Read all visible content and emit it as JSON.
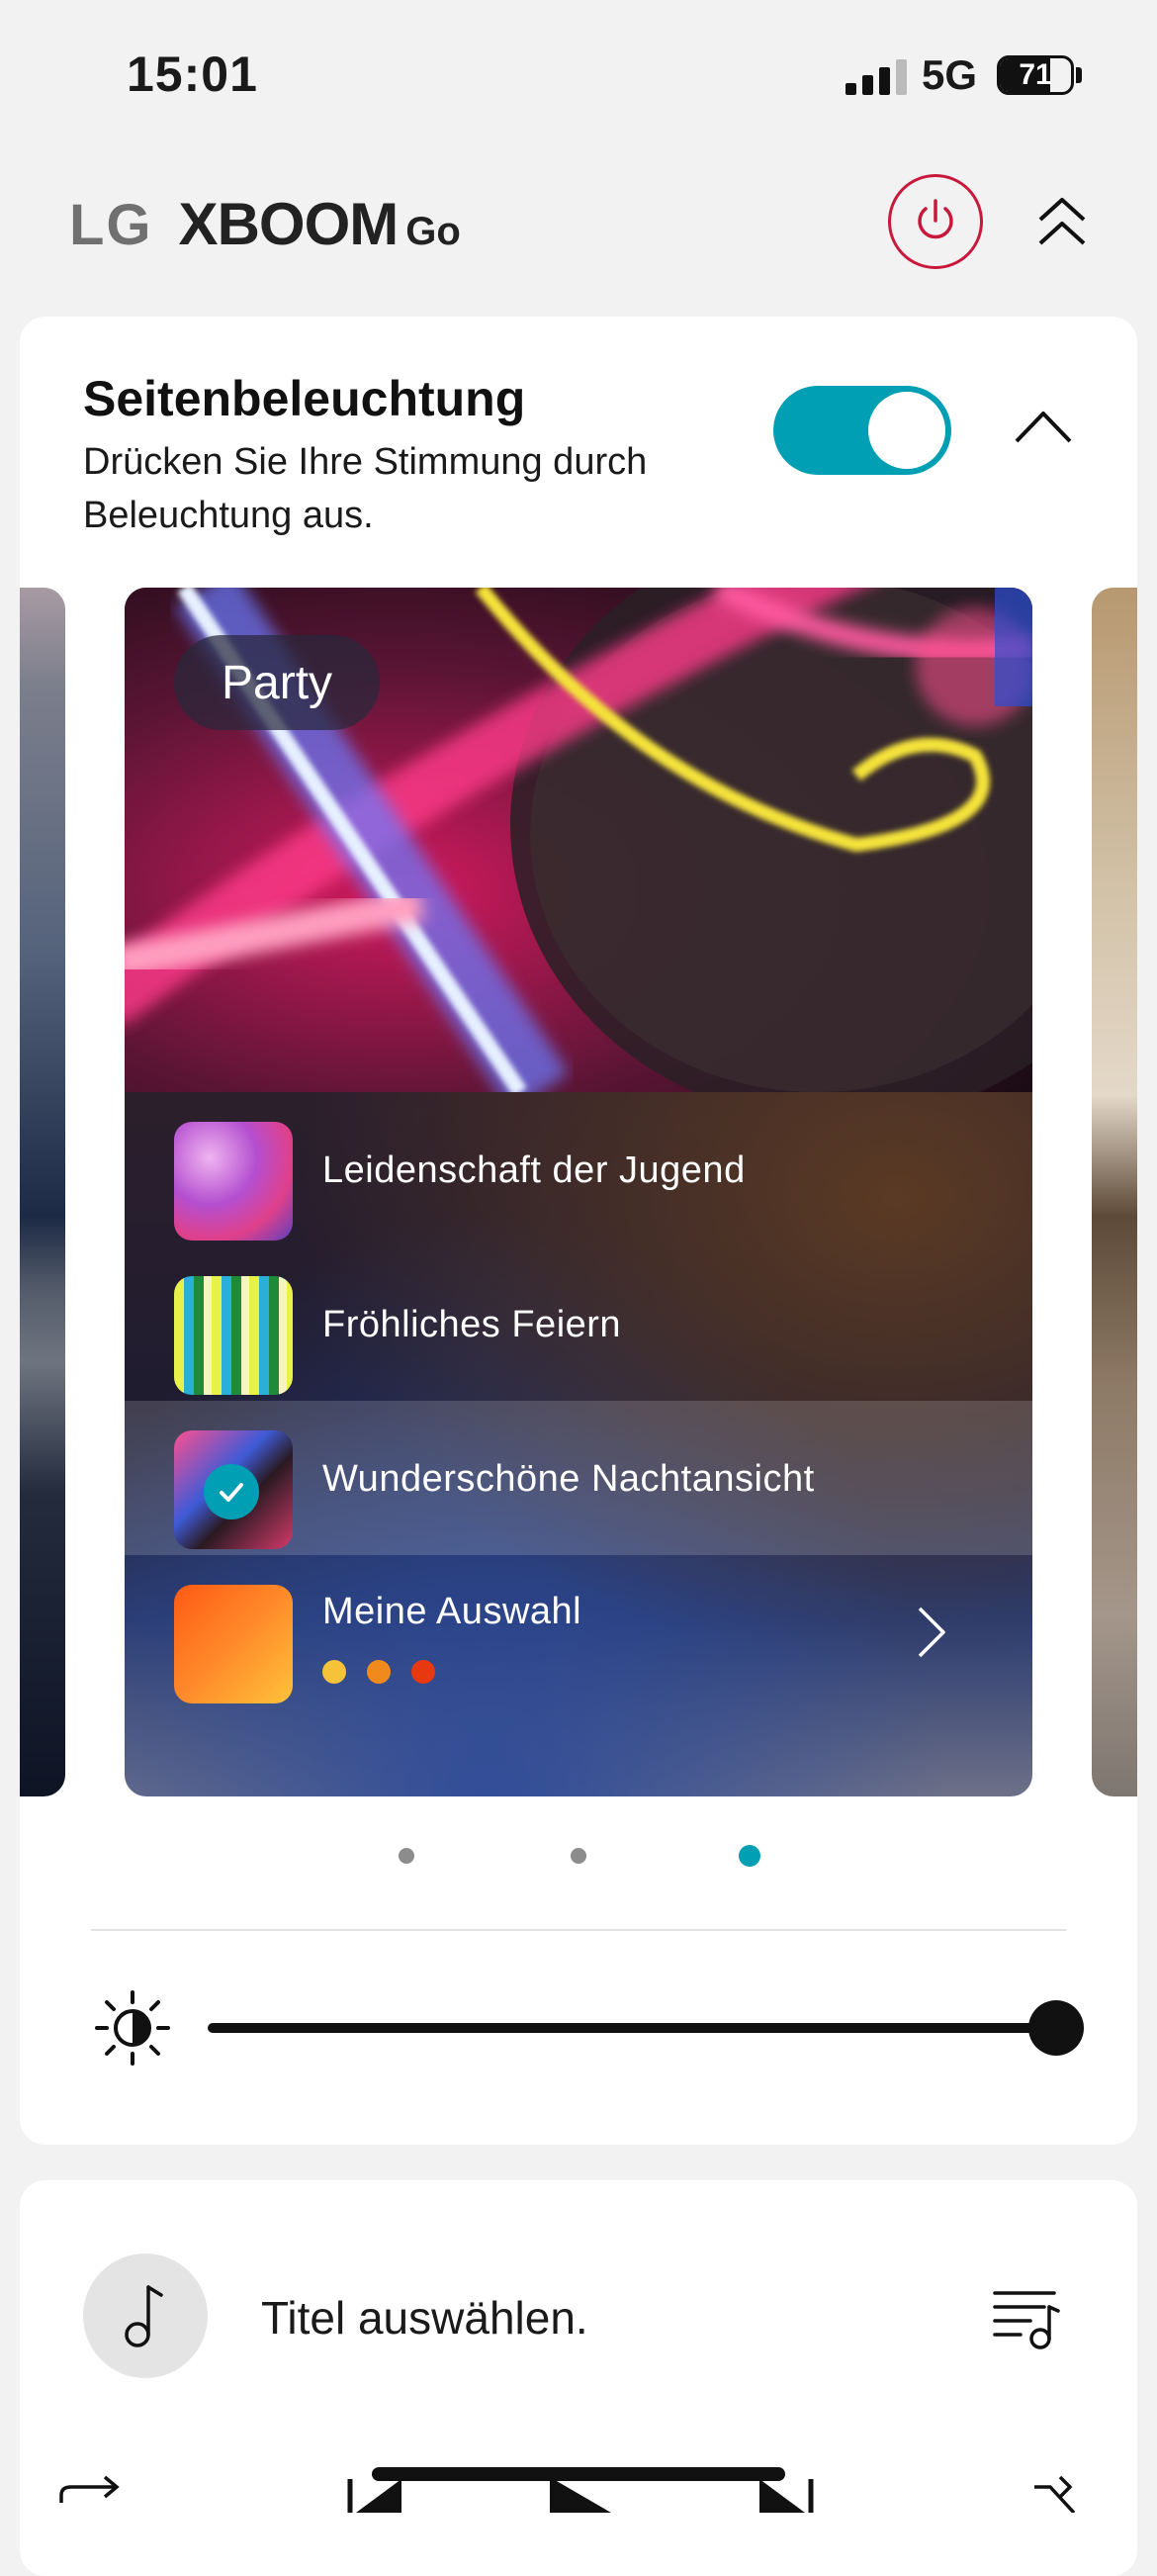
{
  "status_bar": {
    "time": "15:01",
    "network": "5G",
    "battery": "71",
    "battery_level": 0.71
  },
  "header": {
    "logo_brand": "LG",
    "logo_product": "XBOOM",
    "logo_suffix": "Go"
  },
  "lighting": {
    "title": "Seitenbeleuchtung",
    "subtitle": "Drücken Sie Ihre Stimmung durch Beleuchtung aus.",
    "toggle_on": true,
    "card": {
      "category": "Party",
      "items": [
        {
          "label": "Leidenschaft der Jugend",
          "selected": false
        },
        {
          "label": "Fröhliches Feiern",
          "selected": false
        },
        {
          "label": "Wunderschöne Nachtansicht",
          "selected": true
        },
        {
          "label": "Meine Auswahl",
          "selected": false
        }
      ],
      "custom_colors": [
        "#f5c23a",
        "#f08a1c",
        "#e8380f"
      ]
    },
    "pagination": {
      "count": 3,
      "active": 3
    },
    "brightness": 1.0
  },
  "player": {
    "track_placeholder": "Titel auswählen."
  },
  "colors": {
    "accent": "#009fb4",
    "power": "#c8183c"
  }
}
